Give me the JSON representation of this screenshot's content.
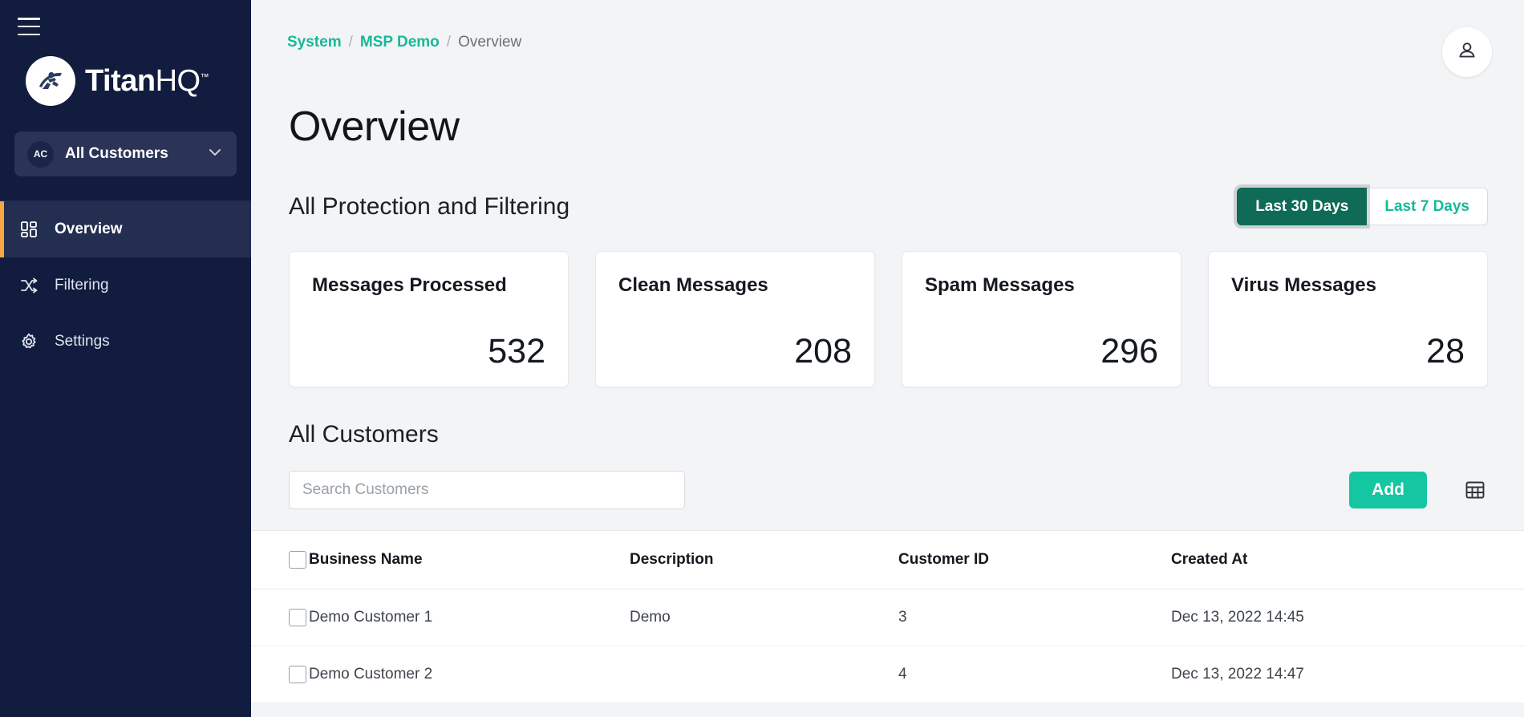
{
  "sidebar": {
    "menu_icon": "hamburger-icon",
    "brand": {
      "bold": "Titan",
      "light": "HQ",
      "tm": "™"
    },
    "customer_selector": {
      "badge": "AC",
      "label": "All Customers",
      "chevron": "chevron-down-icon"
    },
    "items": [
      {
        "label": "Overview",
        "icon": "dashboard-grid-icon",
        "active": true
      },
      {
        "label": "Filtering",
        "icon": "shuffle-icon",
        "active": false
      },
      {
        "label": "Settings",
        "icon": "gear-icon",
        "active": false
      }
    ],
    "colors": {
      "bg": "#121c3e",
      "active_bg": "#242e51",
      "accent_bar": "#f5a742"
    }
  },
  "header": {
    "breadcrumb": [
      {
        "label": "System",
        "type": "link"
      },
      {
        "label": "/",
        "type": "separator"
      },
      {
        "label": "MSP Demo",
        "type": "link"
      },
      {
        "label": "/",
        "type": "separator"
      },
      {
        "label": "Overview",
        "type": "current"
      }
    ],
    "avatar_icon": "user-icon",
    "page_title": "Overview"
  },
  "protection": {
    "section_title": "All Protection and Filtering",
    "range_toggle": {
      "options": [
        {
          "label": "Last 30 Days",
          "active": true
        },
        {
          "label": "Last 7 Days",
          "active": false
        }
      ]
    },
    "stat_cards": [
      {
        "label": "Messages Processed",
        "value": "532"
      },
      {
        "label": "Clean Messages",
        "value": "208"
      },
      {
        "label": "Spam Messages",
        "value": "296"
      },
      {
        "label": "Virus Messages",
        "value": "28"
      }
    ]
  },
  "customers": {
    "section_title": "All Customers",
    "search": {
      "value": "",
      "placeholder": "Search Customers"
    },
    "add_label": "Add",
    "grid_icon": "table-view-icon",
    "table": {
      "columns": [
        "Business Name",
        "Description",
        "Customer ID",
        "Created At"
      ],
      "rows": [
        {
          "name": "Demo Customer 1",
          "description": "Demo",
          "customer_id": "3",
          "created_at": "Dec 13, 2022 14:45"
        },
        {
          "name": "Demo Customer 2",
          "description": "",
          "customer_id": "4",
          "created_at": "Dec 13, 2022 14:47"
        }
      ]
    }
  },
  "colors": {
    "brand_teal": "#17b998",
    "add_green": "#14c6a2",
    "toggle_active": "#0f6b56",
    "sidebar_navy": "#121c3e",
    "page_bg": "#f3f4f6"
  }
}
